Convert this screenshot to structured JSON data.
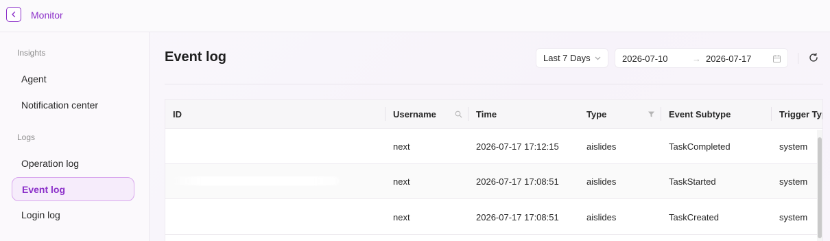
{
  "app": {
    "title": "Monitor"
  },
  "sidebar": {
    "sections": [
      {
        "label": "Insights",
        "items": [
          "Agent",
          "Notification center"
        ]
      },
      {
        "label": "Logs",
        "items": [
          "Operation log",
          "Event log",
          "Login log"
        ]
      }
    ],
    "active_item": "Event log"
  },
  "page": {
    "title": "Event log"
  },
  "filters": {
    "range": "Last 7 Days",
    "date_start": "2026-07-10",
    "date_end": "2026-07-17",
    "separator": "→"
  },
  "table": {
    "columns": [
      "ID",
      "Username",
      "Time",
      "Type",
      "Event Subtype",
      "Trigger Typ"
    ],
    "rows": [
      {
        "id": "",
        "username": "next",
        "time": "2026-07-17 17:12:15",
        "type": "aislides",
        "subtype": "TaskCompleted",
        "trigger": "system"
      },
      {
        "id": "",
        "username": "next",
        "time": "2026-07-17 17:08:51",
        "type": "aislides",
        "subtype": "TaskStarted",
        "trigger": "system"
      },
      {
        "id": "",
        "username": "next",
        "time": "2026-07-17 17:08:51",
        "type": "aislides",
        "subtype": "TaskCreated",
        "trigger": "system"
      }
    ]
  },
  "colors": {
    "accent": "#8b2fc9",
    "active_bg": "#f6ecfb",
    "active_border": "#d9a8ee"
  },
  "icons": {
    "back": "chevron-left-icon",
    "search": "search-icon",
    "filter": "filter-icon",
    "calendar": "calendar-icon",
    "refresh": "refresh-icon",
    "dropdown": "chevron-down-icon"
  }
}
